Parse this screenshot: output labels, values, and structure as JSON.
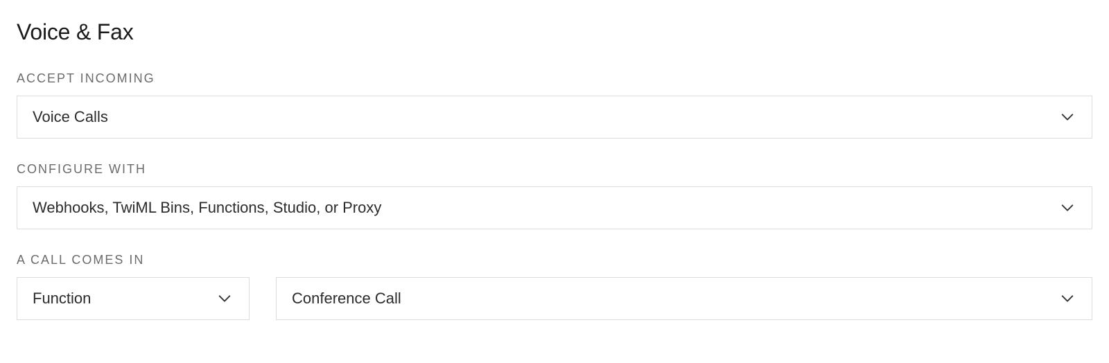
{
  "section": {
    "title": "Voice & Fax"
  },
  "fields": {
    "accept_incoming": {
      "label": "ACCEPT INCOMING",
      "value": "Voice Calls"
    },
    "configure_with": {
      "label": "CONFIGURE WITH",
      "value": "Webhooks, TwiML Bins, Functions, Studio, or Proxy"
    },
    "a_call_comes_in": {
      "label": "A CALL COMES IN",
      "handler_type": "Function",
      "handler_value": "Conference Call"
    }
  }
}
